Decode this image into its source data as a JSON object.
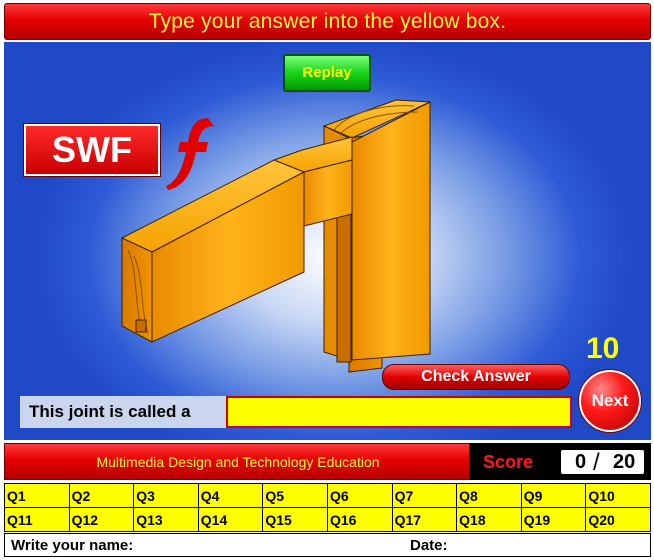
{
  "header": {
    "instruction": "Type your answer into the yellow box."
  },
  "stage": {
    "replay_label": "Replay",
    "logo_text": "SWF",
    "timer": "10",
    "check_label": "Check Answer",
    "next_label": "Next",
    "answer_prompt": "This joint is called a",
    "answer_value": "",
    "answer_placeholder": ""
  },
  "footer": {
    "brand": "Multimedia Design and Technology Education",
    "score_label": "Score",
    "score_current": "0",
    "score_divider": "/",
    "score_total": "20"
  },
  "questions": {
    "row1": [
      "Q1",
      "Q2",
      "Q3",
      "Q4",
      "Q5",
      "Q6",
      "Q7",
      "Q8",
      "Q9",
      "Q10"
    ],
    "row2": [
      "Q11",
      "Q12",
      "Q13",
      "Q14",
      "Q15",
      "Q16",
      "Q17",
      "Q18",
      "Q19",
      "Q20"
    ]
  },
  "student": {
    "name_label": "Write your name:",
    "date_label": "Date:"
  },
  "colors": {
    "title_text": "#ffff33",
    "banner_red": "#e60000",
    "stage_blue": "#2049c8",
    "answer_yellow": "#ffff00",
    "wood": "#f5a300",
    "replay_green": "#19d419"
  },
  "icons": [
    "flash-f-icon",
    "joint-illustration"
  ]
}
